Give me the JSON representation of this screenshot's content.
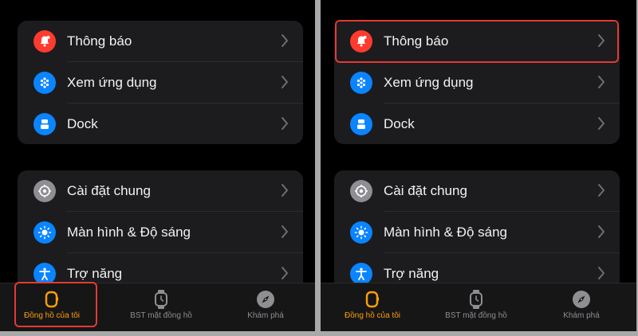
{
  "colors": {
    "accent": "#ff9f0a",
    "highlight": "#e53935",
    "notifications_icon": "#ff3b30",
    "blue_icon": "#0a84ff",
    "gray_icon": "#8e8e93"
  },
  "panels": [
    {
      "group1": [
        {
          "label": "Thông báo",
          "icon": "bell-icon"
        },
        {
          "label": "Xem ứng dụng",
          "icon": "app-grid-icon"
        },
        {
          "label": "Dock",
          "icon": "dock-icon"
        }
      ],
      "group2": [
        {
          "label": "Cài đặt chung",
          "icon": "gear-icon"
        },
        {
          "label": "Màn hình & Độ sáng",
          "icon": "brightness-icon"
        },
        {
          "label": "Trợ năng",
          "icon": "accessibility-icon"
        }
      ],
      "tabs": [
        {
          "label": "Đồng hồ của tôi",
          "icon": "watch-icon",
          "active": true
        },
        {
          "label": "BST mặt đồng hồ",
          "icon": "watch-face-icon",
          "active": false
        },
        {
          "label": "Khám phá",
          "icon": "compass-icon",
          "active": false
        }
      ],
      "highlighted": "tab-my-watch"
    },
    {
      "group1": [
        {
          "label": "Thông báo",
          "icon": "bell-icon"
        },
        {
          "label": "Xem ứng dụng",
          "icon": "app-grid-icon"
        },
        {
          "label": "Dock",
          "icon": "dock-icon"
        }
      ],
      "group2": [
        {
          "label": "Cài đặt chung",
          "icon": "gear-icon"
        },
        {
          "label": "Màn hình & Độ sáng",
          "icon": "brightness-icon"
        },
        {
          "label": "Trợ năng",
          "icon": "accessibility-icon"
        }
      ],
      "tabs": [
        {
          "label": "Đồng hồ của tôi",
          "icon": "watch-icon",
          "active": true
        },
        {
          "label": "BST mặt đồng hồ",
          "icon": "watch-face-icon",
          "active": false
        },
        {
          "label": "Khám phá",
          "icon": "compass-icon",
          "active": false
        }
      ],
      "highlighted": "notifications-row"
    }
  ]
}
